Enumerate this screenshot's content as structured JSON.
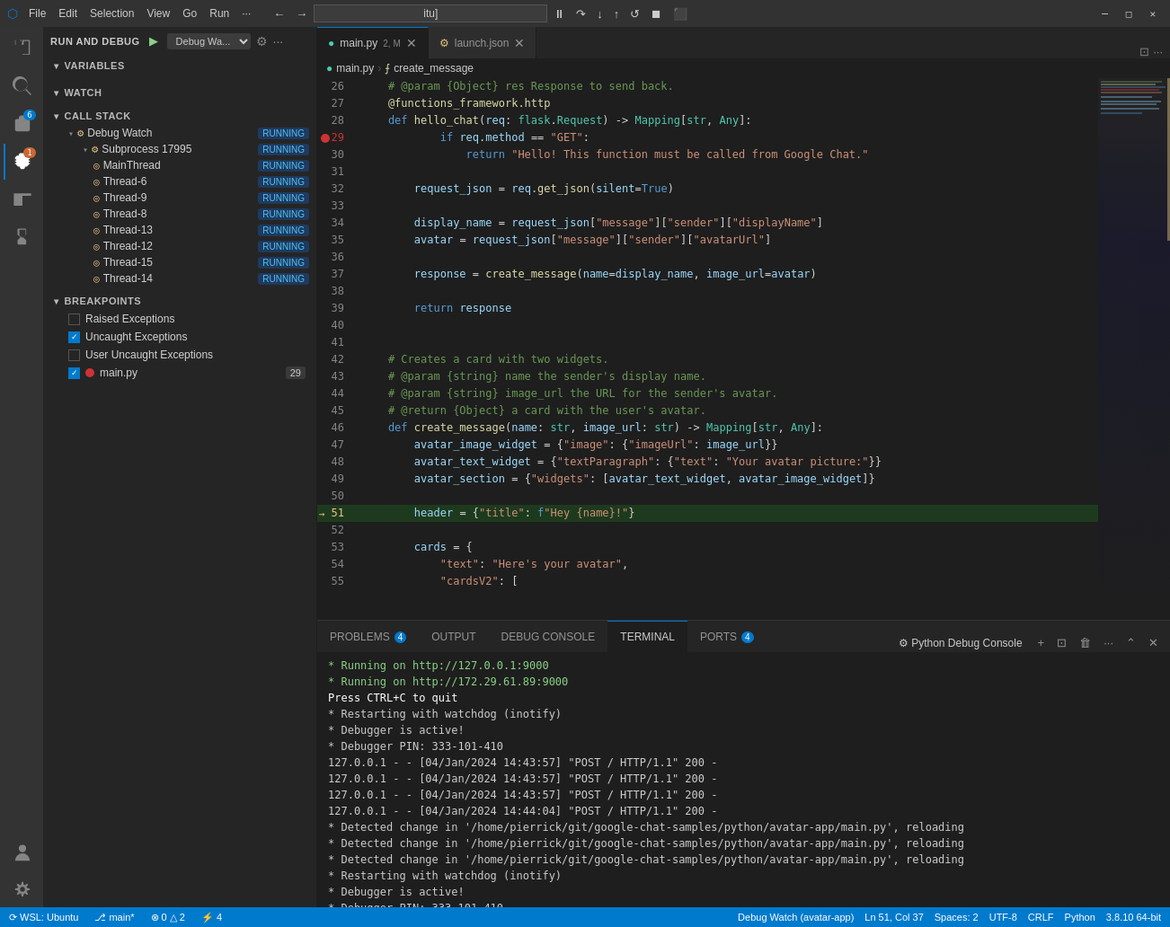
{
  "titlebar": {
    "icon": "⬡",
    "menus": [
      "File",
      "Edit",
      "Selection",
      "View",
      "Go",
      "Run",
      "..."
    ],
    "address": "itu]",
    "window_controls": [
      "─",
      "□",
      "✕"
    ]
  },
  "debug_toolbar": {
    "buttons": [
      "⏸",
      "↺",
      "⟳",
      "↓",
      "↑",
      "→",
      "⏹",
      "⬛"
    ]
  },
  "tabs": [
    {
      "id": "main_py",
      "label": "main.py",
      "badge": "2, M",
      "icon": "🐍",
      "active": true,
      "modified": true
    },
    {
      "id": "launch_json",
      "label": "launch.json",
      "icon": "⚙",
      "active": false
    }
  ],
  "breadcrumb": {
    "file": "main.py",
    "separator": ">",
    "function": "create_message"
  },
  "code_lines": [
    {
      "num": 26,
      "content": "    # @param {Object} res Response to send back.",
      "type": "comment"
    },
    {
      "num": 27,
      "content": "    @functions_framework.http",
      "type": "decorator"
    },
    {
      "num": 28,
      "content": "    def hello_chat(req: flask.Request) -> Mapping[str, Any]:",
      "type": "code"
    },
    {
      "num": 29,
      "content": "        if req.method == \"GET\":",
      "type": "code",
      "breakpoint": true
    },
    {
      "num": 30,
      "content": "            return \"Hello! This function must be called from Google Chat.\"",
      "type": "code"
    },
    {
      "num": 31,
      "content": "",
      "type": "empty"
    },
    {
      "num": 32,
      "content": "        request_json = req.get_json(silent=True)",
      "type": "code"
    },
    {
      "num": 33,
      "content": "",
      "type": "empty"
    },
    {
      "num": 34,
      "content": "        display_name = request_json[\"message\"][\"sender\"][\"displayName\"]",
      "type": "code"
    },
    {
      "num": 35,
      "content": "        avatar = request_json[\"message\"][\"sender\"][\"avatarUrl\"]",
      "type": "code"
    },
    {
      "num": 36,
      "content": "",
      "type": "empty"
    },
    {
      "num": 37,
      "content": "        response = create_message(name=display_name, image_url=avatar)",
      "type": "code"
    },
    {
      "num": 38,
      "content": "",
      "type": "empty"
    },
    {
      "num": 39,
      "content": "        return response",
      "type": "code"
    },
    {
      "num": 40,
      "content": "",
      "type": "empty"
    },
    {
      "num": 41,
      "content": "",
      "type": "empty"
    },
    {
      "num": 42,
      "content": "    # Creates a card with two widgets.",
      "type": "comment"
    },
    {
      "num": 43,
      "content": "    # @param {string} name the sender's display name.",
      "type": "comment"
    },
    {
      "num": 44,
      "content": "    # @param {string} image_url the URL for the sender's avatar.",
      "type": "comment"
    },
    {
      "num": 45,
      "content": "    # @return {Object} a card with the user's avatar.",
      "type": "comment"
    },
    {
      "num": 46,
      "content": "    def create_message(name: str, image_url: str) -> Mapping[str, Any]:",
      "type": "code"
    },
    {
      "num": 47,
      "content": "        avatar_image_widget = {\"image\": {\"imageUrl\": image_url}}",
      "type": "code"
    },
    {
      "num": 48,
      "content": "        avatar_text_widget = {\"textParagraph\": {\"text\": \"Your avatar picture:\"}}",
      "type": "code"
    },
    {
      "num": 49,
      "content": "        avatar_section = {\"widgets\": [avatar_text_widget, avatar_image_widget]}",
      "type": "code"
    },
    {
      "num": 50,
      "content": "",
      "type": "empty"
    },
    {
      "num": 51,
      "content": "        header = {\"title\": f\"Hey {name}!\"}",
      "type": "code",
      "current": true
    },
    {
      "num": 52,
      "content": "",
      "type": "empty"
    },
    {
      "num": 53,
      "content": "        cards = {",
      "type": "code"
    },
    {
      "num": 54,
      "content": "            \"text\": \"Here's your avatar\",",
      "type": "code"
    },
    {
      "num": 55,
      "content": "            \"cardsV2\": [",
      "type": "code"
    }
  ],
  "sidebar": {
    "debug_title": "RUN AND DEBUG",
    "config": "Debug Wa...",
    "variables_header": "VARIABLES",
    "watch_header": "WATCH",
    "callstack_header": "CALL STACK",
    "breakpoints_header": "BREAKPOINTS",
    "callstack_items": [
      {
        "label": "Debug Watch",
        "level": 1,
        "expanded": true,
        "status": "RUNNING",
        "icon": "thread"
      },
      {
        "label": "Subprocess 17995",
        "level": 2,
        "expanded": true,
        "status": "RUNNING",
        "icon": "subprocess"
      },
      {
        "label": "MainThread",
        "level": 3,
        "status": "RUNNING"
      },
      {
        "label": "Thread-6",
        "level": 3,
        "status": "RUNNING"
      },
      {
        "label": "Thread-9",
        "level": 3,
        "status": "RUNNING"
      },
      {
        "label": "Thread-8",
        "level": 3,
        "status": "RUNNING"
      },
      {
        "label": "Thread-13",
        "level": 3,
        "status": "RUNNING"
      },
      {
        "label": "Thread-12",
        "level": 3,
        "status": "RUNNING"
      },
      {
        "label": "Thread-15",
        "level": 3,
        "status": "RUNNING"
      },
      {
        "label": "Thread-14",
        "level": 3,
        "status": "RUNNING"
      }
    ],
    "breakpoints": [
      {
        "label": "Raised Exceptions",
        "checked": false,
        "type": "checkbox"
      },
      {
        "label": "Uncaught Exceptions",
        "checked": true,
        "type": "checkbox"
      },
      {
        "label": "User Uncaught Exceptions",
        "checked": false,
        "type": "checkbox"
      },
      {
        "label": "main.py",
        "checked": true,
        "type": "file",
        "line": "29",
        "badge": "29"
      }
    ]
  },
  "panel": {
    "tabs": [
      {
        "label": "PROBLEMS",
        "badge": "4"
      },
      {
        "label": "OUTPUT"
      },
      {
        "label": "DEBUG CONSOLE"
      },
      {
        "label": "TERMINAL",
        "active": true
      },
      {
        "label": "PORTS",
        "badge": "4"
      }
    ],
    "terminal_label": "Python Debug Console",
    "terminal_lines": [
      {
        "text": " * Running on http://127.0.0.1:9000",
        "color": "green"
      },
      {
        "text": " * Running on http://172.29.61.89:9000",
        "color": "green"
      },
      {
        "text": "Press CTRL+C to quit",
        "color": "bold"
      },
      {
        "text": " * Restarting with watchdog (inotify)",
        "color": "white"
      },
      {
        "text": " * Debugger is active!",
        "color": "white"
      },
      {
        "text": " * Debugger PIN: 333-101-410",
        "color": "white"
      },
      {
        "text": "127.0.0.1 - - [04/Jan/2024 14:43:57] \"POST / HTTP/1.1\" 200 -",
        "color": "white"
      },
      {
        "text": "127.0.0.1 - - [04/Jan/2024 14:43:57] \"POST / HTTP/1.1\" 200 -",
        "color": "white"
      },
      {
        "text": "127.0.0.1 - - [04/Jan/2024 14:43:57] \"POST / HTTP/1.1\" 200 -",
        "color": "white"
      },
      {
        "text": "127.0.0.1 - - [04/Jan/2024 14:44:04] \"POST / HTTP/1.1\" 200 -",
        "color": "white"
      },
      {
        "text": " * Detected change in '/home/pierrick/git/google-chat-samples/python/avatar-app/main.py', reloading",
        "color": "white"
      },
      {
        "text": " * Detected change in '/home/pierrick/git/google-chat-samples/python/avatar-app/main.py', reloading",
        "color": "white"
      },
      {
        "text": " * Detected change in '/home/pierrick/git/google-chat-samples/python/avatar-app/main.py', reloading",
        "color": "white"
      },
      {
        "text": " * Restarting with watchdog (inotify)",
        "color": "white"
      },
      {
        "text": " * Debugger is active!",
        "color": "white"
      },
      {
        "text": " * Debugger PIN: 333-101-410",
        "color": "white"
      },
      {
        "text": "▊",
        "color": "white"
      }
    ]
  },
  "statusbar": {
    "left": [
      {
        "icon": "⟳",
        "text": "WSL: Ubuntu"
      },
      {
        "icon": "⎇",
        "text": "main*"
      },
      {
        "icon": "",
        "text": "⊗ 0 △ 2"
      },
      {
        "icon": "",
        "text": "⚡ 4"
      }
    ],
    "right": [
      {
        "text": "Debug Watch (avatar-app)"
      },
      {
        "text": "Ln 51, Col 37"
      },
      {
        "text": "Spaces: 2"
      },
      {
        "text": "UTF-8"
      },
      {
        "text": "CRLF"
      },
      {
        "text": "Python"
      },
      {
        "text": "3.8.10 64-bit"
      }
    ]
  }
}
